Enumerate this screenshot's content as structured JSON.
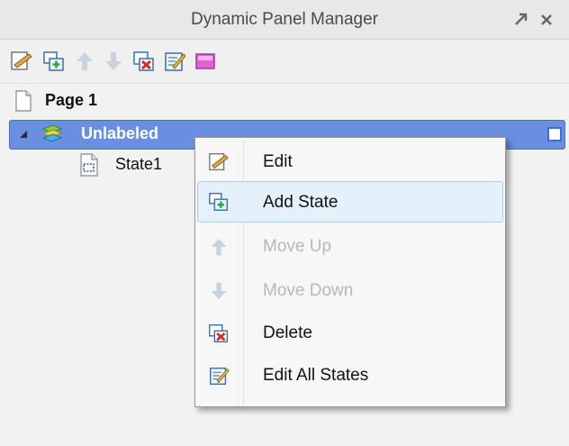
{
  "panel": {
    "title": "Dynamic Panel Manager"
  },
  "tree": {
    "page_label": "Page 1",
    "panel_label": "Unlabeled",
    "state_label": "State1"
  },
  "context_menu": {
    "items": [
      {
        "label": "Edit",
        "icon": "edit-icon",
        "enabled": true
      },
      {
        "label": "Add State",
        "icon": "add-state-icon",
        "enabled": true,
        "highlighted": true
      },
      {
        "label": "Move Up",
        "icon": "arrow-up-icon",
        "enabled": false
      },
      {
        "label": "Move Down",
        "icon": "arrow-down-icon",
        "enabled": false
      },
      {
        "label": "Delete",
        "icon": "delete-icon",
        "enabled": true
      },
      {
        "label": "Edit All States",
        "icon": "edit-all-icon",
        "enabled": true
      }
    ]
  },
  "colors": {
    "selection": "#6a8fe0",
    "highlight": "#e4f0fa",
    "disabled_text": "#b8b8b8"
  }
}
